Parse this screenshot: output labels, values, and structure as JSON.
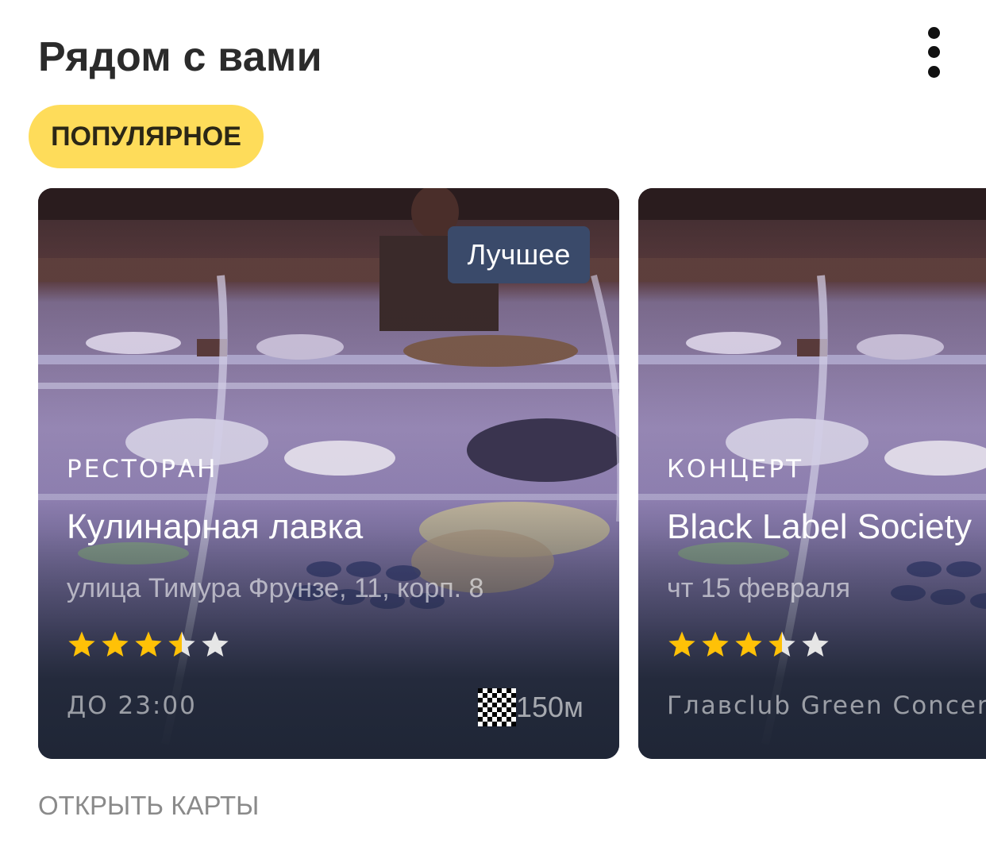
{
  "header": {
    "title": "Рядом с вами",
    "menu_icon": "more-vertical-icon"
  },
  "filter_chip": {
    "label": "ПОПУЛЯРНОЕ",
    "color": "#fedc5a"
  },
  "cards": [
    {
      "badge": "Лучшее",
      "category": "РЕСТОРАН",
      "title": "Кулинарная лавка",
      "subtitle": "улица Тимура Фрунзе, 11, корп. 8",
      "rating": 3.5,
      "rating_max": 5,
      "footer_left": "ДО 23:00",
      "distance": "150м",
      "distance_icon": "checkered-flag-icon"
    },
    {
      "category": "КОНЦЕРТ",
      "title": "Black Label Society",
      "subtitle": "чт 15 февраля",
      "rating": 3.5,
      "rating_max": 5,
      "footer_left": "Главclub Green Concert"
    }
  ],
  "footer": {
    "open_maps": "ОТКРЫТЬ КАРТЫ"
  },
  "colors": {
    "star_filled": "#ffc107",
    "star_empty": "#e6e6e6",
    "badge_bg": "#3a4a6a",
    "card_bottom": "#1f2636"
  }
}
